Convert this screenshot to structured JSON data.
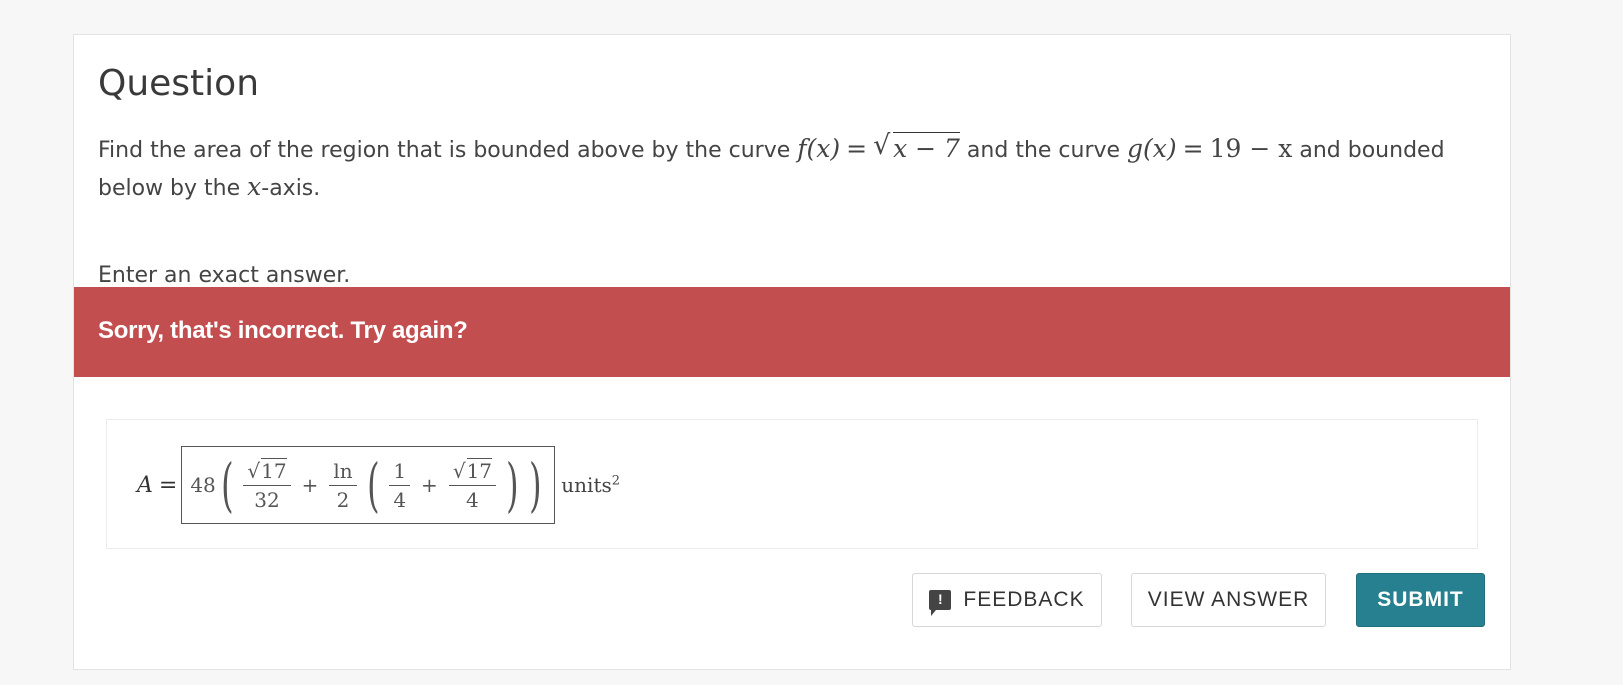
{
  "question": {
    "title": "Question",
    "prompt": {
      "t1": "Find the area of the region that is bounded above by the curve ",
      "f_lhs": "f(x)",
      "eq": "=",
      "f_rad": "x − 7",
      "t2": " and the curve ",
      "g_lhs": "g(x)",
      "g_rhs": "19 − x",
      "t3": " and bounded below by the ",
      "xvar": "x",
      "t4": "-axis."
    },
    "instruction": "Enter an exact answer."
  },
  "feedback": {
    "message": "Sorry, that's incorrect. Try again?",
    "color": "#c24e4f"
  },
  "answer": {
    "variable": "A",
    "equals": "=",
    "coef": "48",
    "frac1_num": "17",
    "frac1_den": "32",
    "plus": "+",
    "frac2_num": "ln",
    "frac2_den": "2",
    "frac3_num": "1",
    "frac3_den": "4",
    "frac4_num": "17",
    "frac4_den": "4",
    "units": "units",
    "units_power": "2"
  },
  "buttons": {
    "feedback": "FEEDBACK",
    "feedback_icon": "comment-alert-icon",
    "view_answer": "VIEW ANSWER",
    "submit": "SUBMIT",
    "submit_color": "#26808f"
  }
}
